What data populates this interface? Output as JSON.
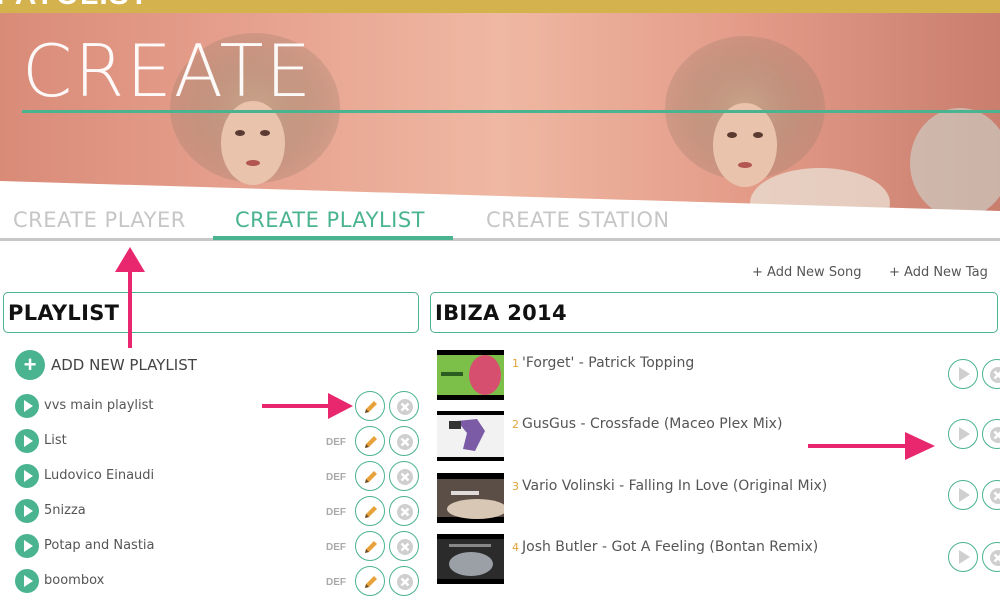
{
  "header": {
    "title_fragment": "PAYOLIST"
  },
  "hero": {
    "title": "CREATE"
  },
  "tabs": [
    {
      "label": "CREATE PLAYER",
      "active": false
    },
    {
      "label": "CREATE PLAYLIST",
      "active": true
    },
    {
      "label": "CREATE STATION",
      "active": false
    }
  ],
  "actions": {
    "add_song": "+ Add New Song",
    "add_tag": "+ Add New Tag"
  },
  "left_panel": {
    "title": "PLAYLIST",
    "add_label": "ADD NEW PLAYLIST",
    "playlists": [
      {
        "name": "vvs main playlist",
        "def": ""
      },
      {
        "name": "List",
        "def": "DEF"
      },
      {
        "name": "Ludovico Einaudi",
        "def": "DEF"
      },
      {
        "name": "5nizza",
        "def": "DEF"
      },
      {
        "name": "Potap and Nastia",
        "def": "DEF"
      },
      {
        "name": "boombox",
        "def": "DEF"
      }
    ]
  },
  "right_panel": {
    "title": "IBIZA 2014",
    "songs": [
      {
        "num": "1",
        "title": "'Forget' - Patrick Topping"
      },
      {
        "num": "2",
        "title": "GusGus - Crossfade (Maceo Plex Mix)"
      },
      {
        "num": "3",
        "title": "Vario Volinski - Falling In Love (Original Mix)"
      },
      {
        "num": "4",
        "title": "Josh Butler - Got A Feeling (Bontan Remix)"
      }
    ]
  },
  "colors": {
    "accent": "#4ab38f",
    "gold": "#d4b24e",
    "arrow": "#e8276e"
  },
  "icons": {
    "play": "play-icon",
    "edit": "pencil-icon",
    "delete": "close-icon",
    "add": "plus-icon"
  }
}
